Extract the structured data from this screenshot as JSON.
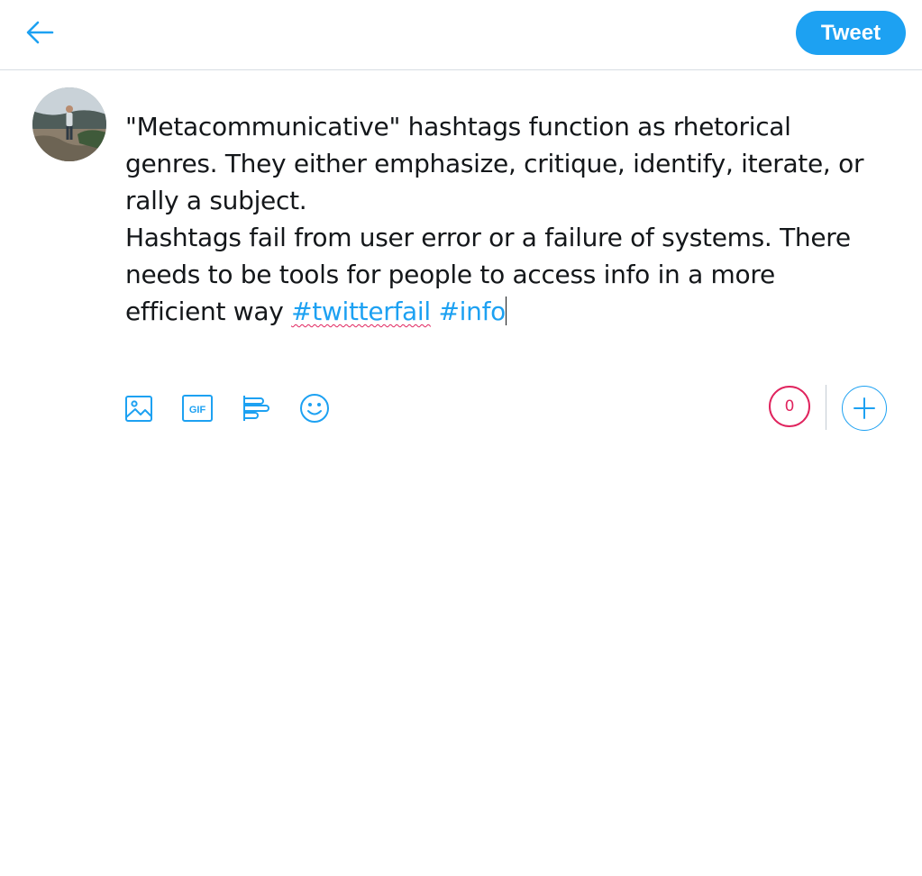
{
  "header": {
    "back_icon": "arrow-left-icon",
    "tweet_label": "Tweet"
  },
  "composer": {
    "avatar_icon": "user-avatar",
    "text_lines": [
      "\"Metacommunicative\" hashtags function as rhetorical",
      "genres. They either emphasize, critique, identify, iterate, or",
      "rally a subject.",
      "Hashtags fail from user error or a failure of systems. There",
      "needs to be tools for people to access info in a more"
    ],
    "last_line_prefix": "efficient way ",
    "hashtag_1": "#twitterfail",
    "hashtag_2": "#info"
  },
  "toolbar": {
    "tools": [
      "image-icon",
      "gif-icon",
      "poll-icon",
      "emoji-icon"
    ],
    "gif_text": "GIF",
    "char_counter": "0",
    "add_icon": "plus-icon"
  },
  "colors": {
    "accent": "#1da1f2",
    "counter_warning": "#e0245e",
    "text": "#14171a"
  }
}
